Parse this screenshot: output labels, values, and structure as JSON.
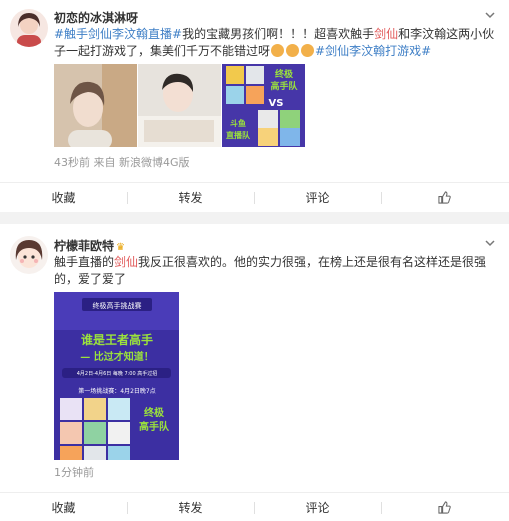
{
  "colors": {
    "tag": "#3f7fc6",
    "highlight": "#e15a5a",
    "meta": "#999999",
    "poster_bg": "#3c2fa2",
    "accent_green": "#9be23c"
  },
  "posts": [
    {
      "username": "初恋的冰淇淋呀",
      "text": {
        "tag1": "#触手剑仙李汶翰直播#",
        "part1": "我的宝藏男孩们啊！！！超喜欢触手",
        "hl1": "剑仙",
        "part2": "和李汶翰这两小伙子一起打游戏了，集美们千万不能错过呀",
        "tag2": "#剑仙李汶翰打游戏#"
      },
      "images": [
        {
          "type": "photo",
          "alt": "photo-1"
        },
        {
          "type": "photo",
          "alt": "photo-2"
        },
        {
          "type": "poster",
          "texts": [
            "终极",
            "高手队",
            "VS",
            "斗鱼",
            "直播队"
          ]
        }
      ],
      "meta": "43秒前 来自 新浪微博4G版",
      "actions": [
        "收藏",
        "转发",
        "评论"
      ]
    },
    {
      "username": "柠檬菲欧特",
      "badge_icon": "gold-crown-icon",
      "text": {
        "part1": "触手直播的",
        "hl1": "剑仙",
        "part2": "我反正很喜欢的。他的实力很强，在榜上还是很有名这样还是很强的，爱了爱了"
      },
      "poster": {
        "header": "终极高手挑战赛",
        "line1": "谁是王者高手",
        "line2": "— 比过才知道！",
        "date": "4月2日-4月6日 每晚 7:00 高手过招",
        "round": "第一场挑战赛：4月2日晚7点",
        "team": [
          "终极",
          "高手队"
        ]
      },
      "meta": "1分钟前",
      "actions": [
        "收藏",
        "转发",
        "评论"
      ]
    }
  ]
}
